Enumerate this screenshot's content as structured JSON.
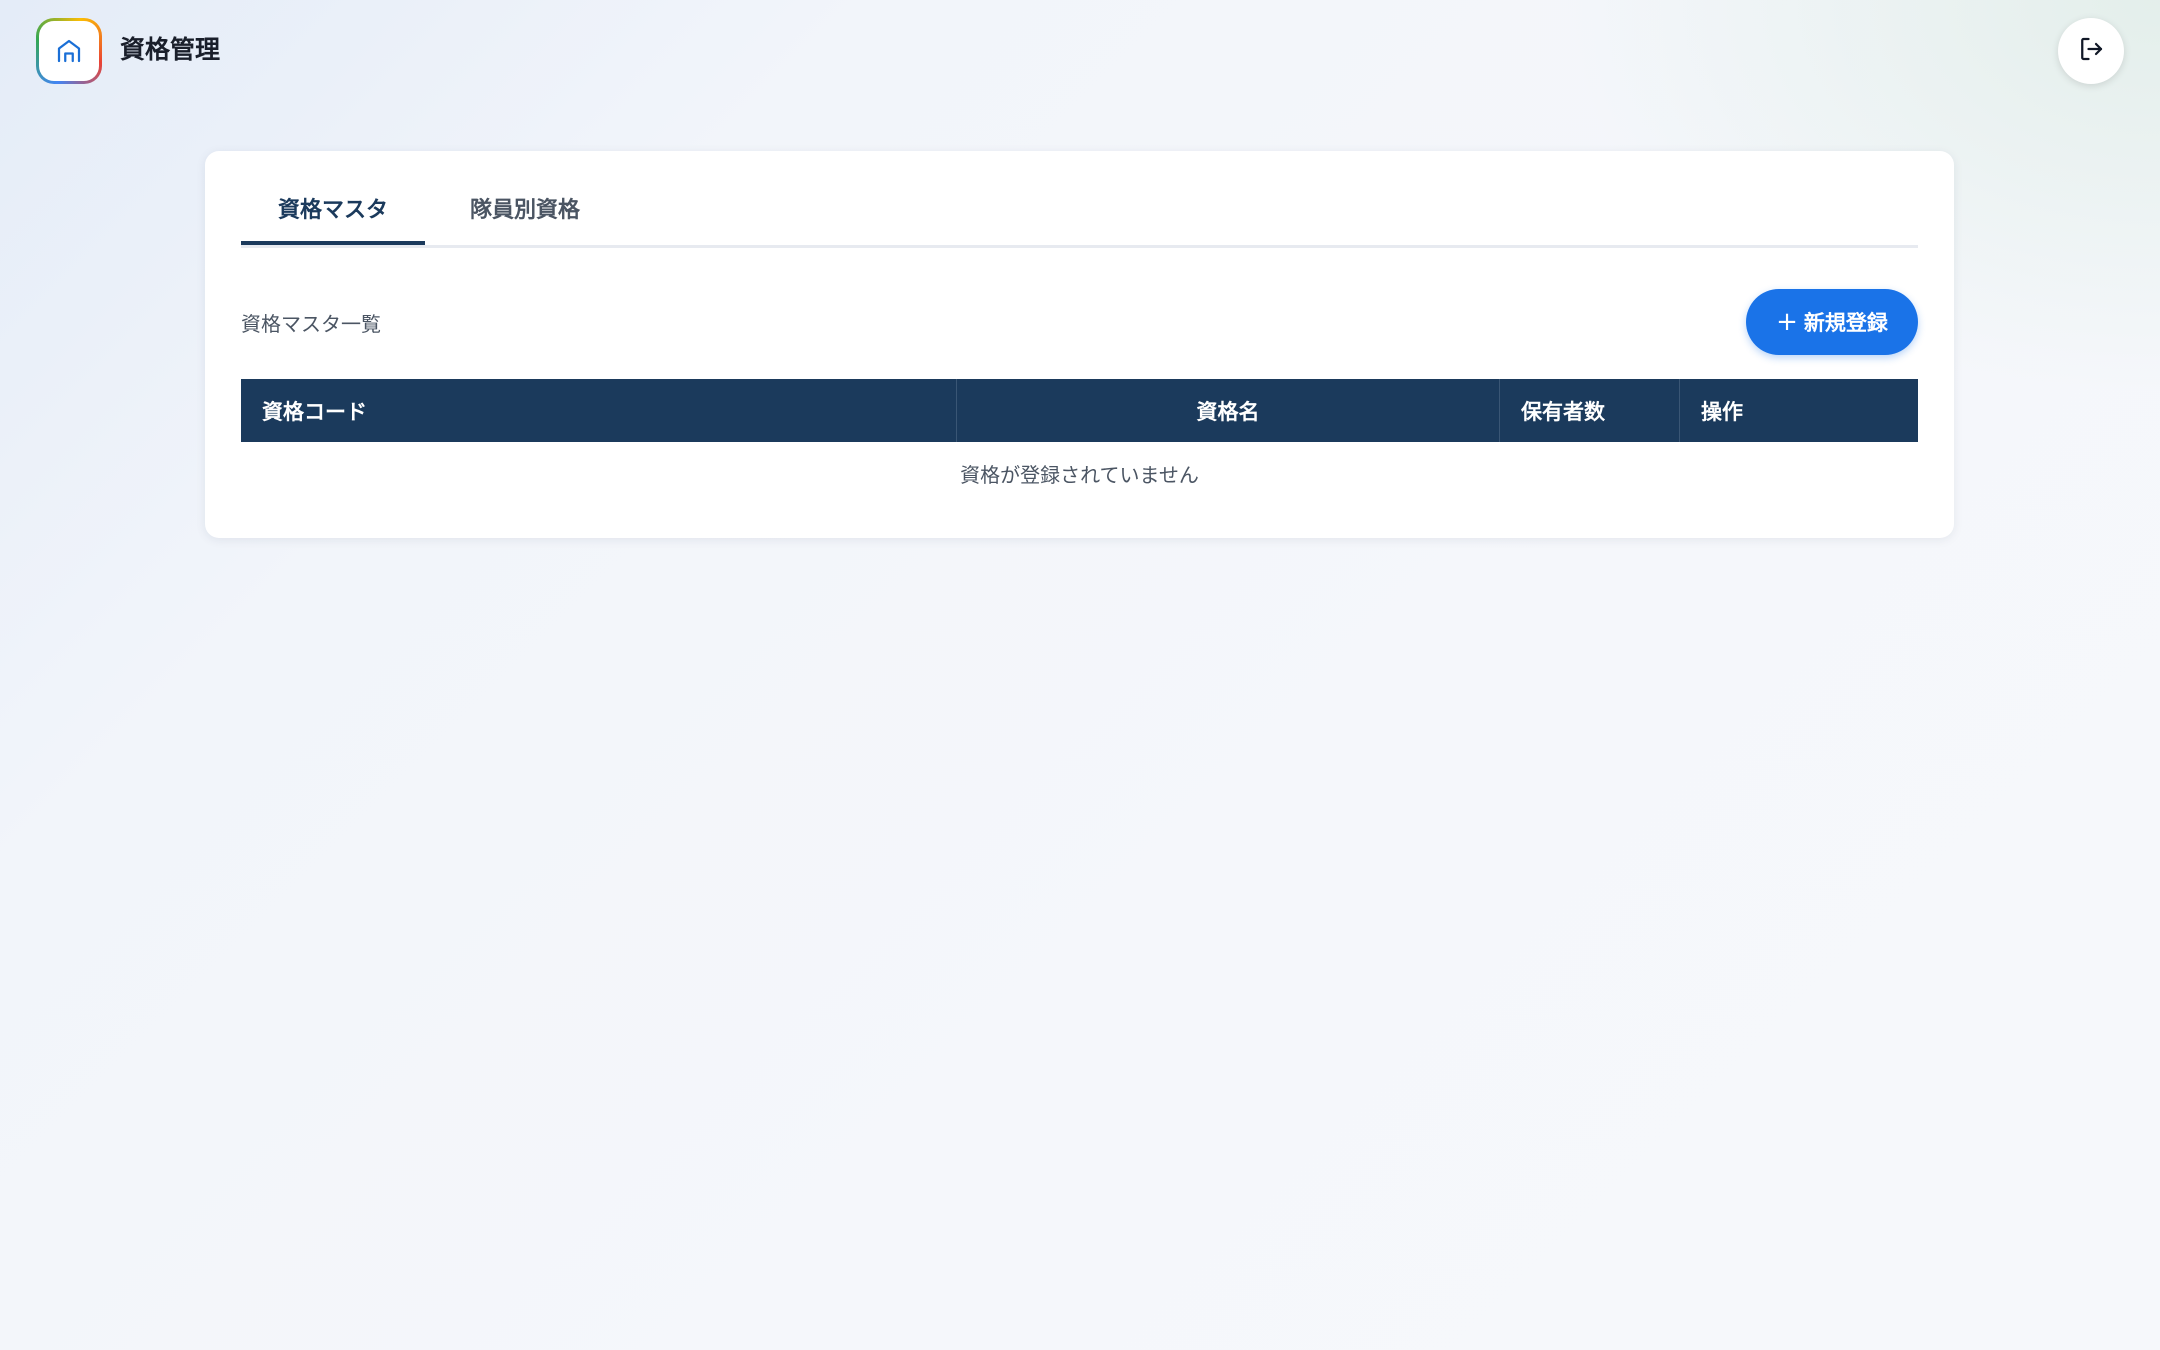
{
  "header": {
    "title": "資格管理",
    "logo_icon": "home-icon",
    "logout_icon": "logout-icon"
  },
  "tabs": [
    {
      "label": "資格マスタ",
      "active": true
    },
    {
      "label": "隊員別資格",
      "active": false
    }
  ],
  "section": {
    "label": "資格マスタ一覧",
    "add_button_label": "新規登録",
    "add_button_icon": "plus-icon"
  },
  "table": {
    "columns": [
      "資格コード",
      "資格名",
      "保有者数",
      "操作"
    ],
    "rows": [],
    "empty_message": "資格が登録されていません"
  },
  "colors": {
    "primary_dark": "#1b3a5c",
    "accent": "#1a73e8"
  }
}
